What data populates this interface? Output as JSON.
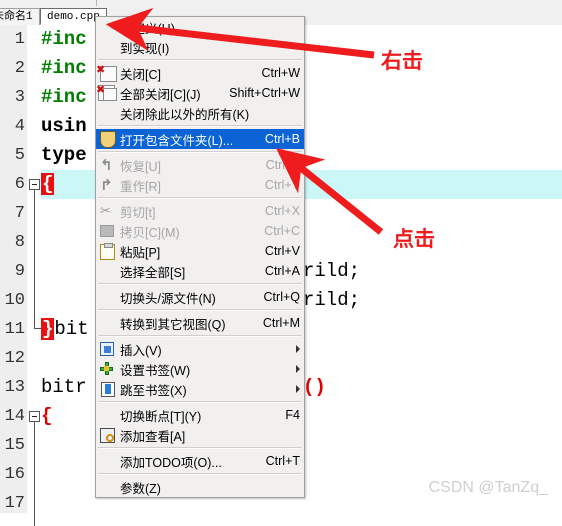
{
  "window": {
    "tabs": [
      {
        "label": "未命名1",
        "active": false
      },
      {
        "label": "demo.cpp",
        "active": true
      }
    ]
  },
  "editor": {
    "lines": [
      {
        "num": "1",
        "text": "#inc",
        "style": "pre"
      },
      {
        "num": "2",
        "text": "#inc",
        "style": "pre"
      },
      {
        "num": "3",
        "text": "#inc",
        "style": "pre"
      },
      {
        "num": "4",
        "text": "usin",
        "style": "kw"
      },
      {
        "num": "5",
        "text": "type",
        "style": "kw"
      },
      {
        "num": "6",
        "text": "{",
        "style": "brace-hl"
      },
      {
        "num": "7",
        "text": "",
        "style": "plain"
      },
      {
        "num": "8",
        "text": "rild;",
        "style": "tail"
      },
      {
        "num": "9",
        "text": "rild;",
        "style": "tail"
      },
      {
        "num": "10",
        "text": "}bit",
        "style": "brace-tail"
      },
      {
        "num": "11",
        "text": "",
        "style": "plain"
      },
      {
        "num": "12",
        "text": "bitr",
        "style": "plain-paren"
      },
      {
        "num": "13",
        "text": "{",
        "style": "punc"
      },
      {
        "num": "14",
        "text": "",
        "style": "plain"
      },
      {
        "num": "15",
        "text": "",
        "style": "plain"
      },
      {
        "num": "16",
        "text": "",
        "style": "plain"
      },
      {
        "num": "17",
        "text": "",
        "style": "plain"
      }
    ],
    "tail_8": "rild;",
    "tail_9": "rild;",
    "tail_12": "()",
    "current_line": "6"
  },
  "context_menu": {
    "items": [
      {
        "label": "到定义(H)",
        "shortcut": "",
        "icon": "",
        "state": "normal",
        "submenu": false
      },
      {
        "label": "到实现(I)",
        "shortcut": "",
        "icon": "",
        "state": "normal",
        "submenu": false
      },
      {
        "separator": true
      },
      {
        "label": "关闭[C]",
        "shortcut": "Ctrl+W",
        "icon": "close-doc-icon",
        "state": "normal",
        "submenu": false
      },
      {
        "label": "全部关闭[C](J)",
        "shortcut": "Shift+Ctrl+W",
        "icon": "close-all-docs-icon",
        "state": "normal",
        "submenu": false
      },
      {
        "label": "关闭除此以外的所有(K)",
        "shortcut": "",
        "icon": "",
        "state": "normal",
        "submenu": false
      },
      {
        "separator": true
      },
      {
        "label": "打开包含文件夹(L)...",
        "shortcut": "Ctrl+B",
        "icon": "shield-folder-icon",
        "state": "selected",
        "submenu": false
      },
      {
        "separator": true
      },
      {
        "label": "恢复[U]",
        "shortcut": "Ctrl+Z",
        "icon": "undo-icon",
        "state": "disabled",
        "submenu": false
      },
      {
        "label": "重作[R]",
        "shortcut": "Ctrl+Y",
        "icon": "redo-icon",
        "state": "disabled",
        "submenu": false
      },
      {
        "separator": true
      },
      {
        "label": "剪切[t]",
        "shortcut": "Ctrl+X",
        "icon": "scissors-icon",
        "state": "disabled",
        "submenu": false
      },
      {
        "label": "拷贝[C](M)",
        "shortcut": "Ctrl+C",
        "icon": "copy-icon",
        "state": "disabled",
        "submenu": false
      },
      {
        "label": "粘贴[P]",
        "shortcut": "Ctrl+V",
        "icon": "paste-icon",
        "state": "normal",
        "submenu": false
      },
      {
        "label": "选择全部[S]",
        "shortcut": "Ctrl+A",
        "icon": "",
        "state": "normal",
        "submenu": false
      },
      {
        "separator": true
      },
      {
        "label": "切换头/源文件(N)",
        "shortcut": "Ctrl+Q",
        "icon": "",
        "state": "normal",
        "submenu": false
      },
      {
        "separator": true
      },
      {
        "label": "转换到其它视图(Q)",
        "shortcut": "Ctrl+M",
        "icon": "",
        "state": "normal",
        "submenu": false
      },
      {
        "separator": true
      },
      {
        "label": "插入(V)",
        "shortcut": "",
        "icon": "insert-icon",
        "state": "normal",
        "submenu": true
      },
      {
        "label": "设置书签(W)",
        "shortcut": "",
        "icon": "add-bookmark-icon",
        "state": "normal",
        "submenu": true
      },
      {
        "label": "跳至书签(X)",
        "shortcut": "",
        "icon": "goto-bookmark-icon",
        "state": "normal",
        "submenu": true
      },
      {
        "separator": true
      },
      {
        "label": "切换断点[T](Y)",
        "shortcut": "F4",
        "icon": "",
        "state": "normal",
        "submenu": false
      },
      {
        "label": "添加查看[A]",
        "shortcut": "",
        "icon": "watch-icon",
        "state": "normal",
        "submenu": false
      },
      {
        "separator": true
      },
      {
        "label": "添加TODO项(O)...",
        "shortcut": "Ctrl+T",
        "icon": "",
        "state": "normal",
        "submenu": false
      },
      {
        "separator": true
      },
      {
        "label": "参数(Z)",
        "shortcut": "",
        "icon": "",
        "state": "normal",
        "submenu": false
      }
    ]
  },
  "annotations": {
    "right_click_label": "右击",
    "click_label": "点击",
    "accent_color": "#ee1c1c"
  },
  "watermark": {
    "text": "CSDN @TanZq_"
  }
}
